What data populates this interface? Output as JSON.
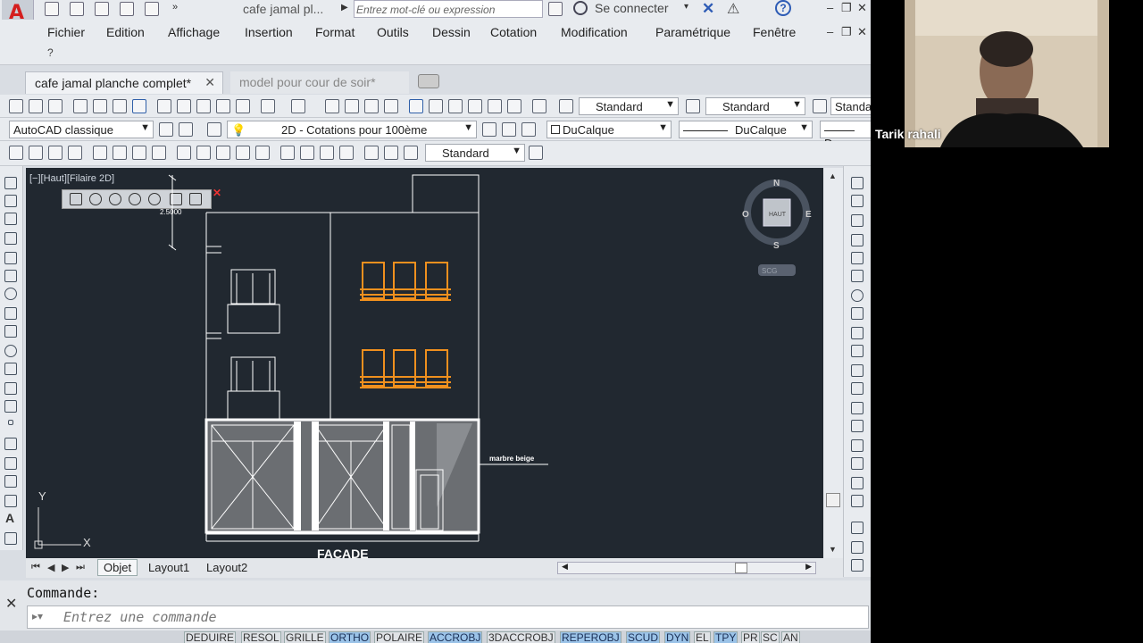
{
  "app": {
    "title": "cafe jamal pl...",
    "search_placeholder": "Entrez mot-clé ou expression",
    "sign_in": "Se connecter",
    "help": "?"
  },
  "menu": {
    "items": [
      "Fichier",
      "Edition",
      "Affichage",
      "Insertion",
      "Format",
      "Outils",
      "Dessin",
      "Cotation",
      "Modification",
      "Paramétrique",
      "Fenêtre"
    ],
    "overflow": "?"
  },
  "doc_tabs": [
    {
      "label": "cafe jamal planche complet*",
      "active": true
    },
    {
      "label": "model pour cour de soir*",
      "active": false
    }
  ],
  "toolbar_dropdowns": {
    "text_style": "Standard",
    "dim_style": "Standard",
    "table_style": "Standa",
    "workspace": "AutoCAD classique",
    "annotation_scale": "2D - Cotations pour 100ème",
    "color": "DuCalque",
    "linetype": "DuCalque",
    "lineweight": "Du",
    "mleader_style": "Standard"
  },
  "viewport": {
    "label": "[−][Haut][Filaire 2D]",
    "dimension_text": "2.5000",
    "annotation": "marbre beige",
    "drawing_title": "FACADE",
    "ucs_y": "Y",
    "ucs_x": "X"
  },
  "viewcube": {
    "n": "N",
    "s": "S",
    "e": "E",
    "w": "O",
    "face": "HAUT",
    "ucs_menu": "SCG"
  },
  "layout_tabs": [
    "Objet",
    "Layout1",
    "Layout2"
  ],
  "command": {
    "label": "Commande:",
    "placeholder": "Entrez une commande"
  },
  "status_toggles": [
    {
      "label": "DEDUIRE",
      "on": false
    },
    {
      "label": "RESOL",
      "on": false
    },
    {
      "label": "GRILLE",
      "on": false
    },
    {
      "label": "ORTHO",
      "on": true
    },
    {
      "label": "POLAIRE",
      "on": false
    },
    {
      "label": "ACCROBJ",
      "on": true
    },
    {
      "label": "3DACCROBJ",
      "on": false
    },
    {
      "label": "REPEROBJ",
      "on": true
    },
    {
      "label": "SCUD",
      "on": true
    },
    {
      "label": "DYN",
      "on": true
    },
    {
      "label": "EL",
      "on": false
    },
    {
      "label": "TPY",
      "on": true
    },
    {
      "label": "PR",
      "on": false
    },
    {
      "label": "SC",
      "on": false
    },
    {
      "label": "AN",
      "on": false
    }
  ],
  "webcam": {
    "participant_name": "Tarik rahali"
  },
  "colors": {
    "canvas_bg": "#212830",
    "window_orange": "#f0901e",
    "line_white": "#ffffff",
    "ortho_on": "#9bc3e8"
  }
}
